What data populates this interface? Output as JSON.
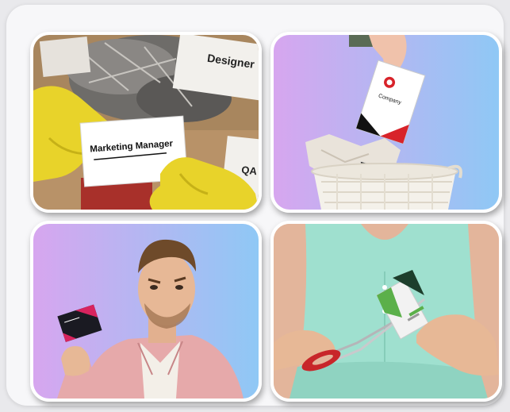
{
  "tiles": [
    {
      "name": "marketing-manager-card-trash",
      "card_title": "Marketing Manager",
      "side_card_designer": "Designer",
      "side_card_qa": "QA"
    },
    {
      "name": "business-card-into-basket",
      "brand_text": "Company"
    },
    {
      "name": "man-holding-business-card"
    },
    {
      "name": "woman-cutting-business-card"
    }
  ],
  "colors": {
    "glove_yellow": "#e8d32a",
    "accent_red": "#d8232a",
    "gradient_left": "#d7a6ef",
    "gradient_right": "#8fc8f5",
    "scissors_red": "#c8262a",
    "dress_mint": "#9fe0cf"
  }
}
